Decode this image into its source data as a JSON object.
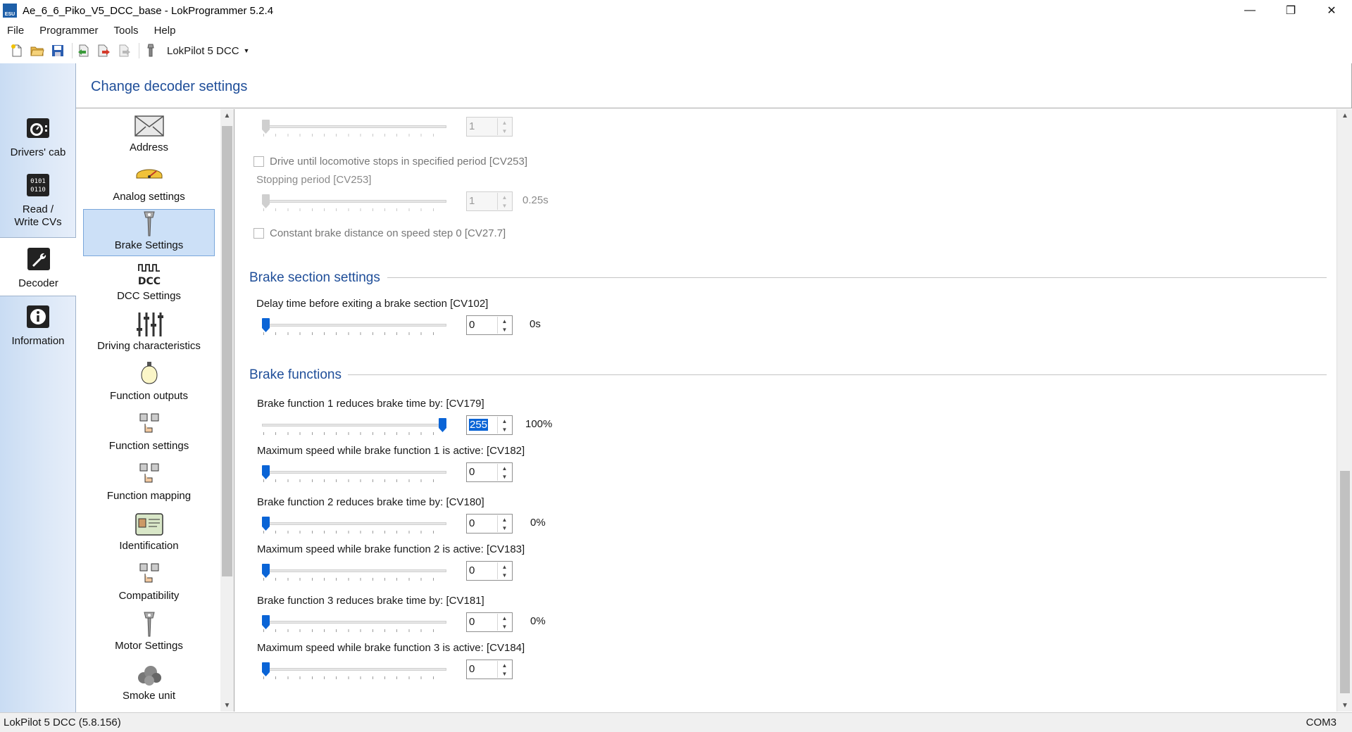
{
  "window": {
    "title": "Ae_6_6_Piko_V5_DCC_base - LokProgrammer 5.2.4",
    "app_icon_text": "ESU"
  },
  "menu": [
    "File",
    "Programmer",
    "Tools",
    "Help"
  ],
  "toolbar": {
    "icons": [
      "new-file-icon",
      "open-folder-icon",
      "save-icon",
      "read-decoder-icon",
      "write-decoder-icon",
      "flash-decoder-icon",
      "decoder-tool-icon"
    ],
    "decoder_select": "LokPilot 5 DCC"
  },
  "leftnav": {
    "items": [
      {
        "label": "Drivers' cab",
        "icon": "drivers-cab-icon"
      },
      {
        "label": "Read / Write CVs",
        "icon": "cv-grid-icon"
      },
      {
        "label": "Decoder",
        "icon": "wrench-icon",
        "active": true
      },
      {
        "label": "Information",
        "icon": "info-icon"
      }
    ]
  },
  "header": {
    "title": "Change decoder settings"
  },
  "categories": [
    {
      "label": "Address",
      "icon": "envelope-icon"
    },
    {
      "label": "Analog settings",
      "icon": "analog-gauge-icon"
    },
    {
      "label": "Brake Settings",
      "icon": "brake-icon",
      "selected": true
    },
    {
      "label": "DCC Settings",
      "icon": "dcc-icon"
    },
    {
      "label": "Driving characteristics",
      "icon": "sliders-icon"
    },
    {
      "label": "Function outputs",
      "icon": "bulb-icon"
    },
    {
      "label": "Function settings",
      "icon": "function-buttons-icon"
    },
    {
      "label": "Function mapping",
      "icon": "function-mapping-icon"
    },
    {
      "label": "Identification",
      "icon": "id-card-icon"
    },
    {
      "label": "Compatibility",
      "icon": "compatibility-icon"
    },
    {
      "label": "Motor Settings",
      "icon": "motor-icon"
    },
    {
      "label": "Smoke unit",
      "icon": "smoke-icon"
    }
  ],
  "content": {
    "top_slider": {
      "value": "1"
    },
    "drive_until_stop": {
      "label": "Drive until locomotive stops in specified period [CV253]",
      "checked": false
    },
    "stopping_period": {
      "label": "Stopping period [CV253]",
      "value": "1",
      "unit": "0.25s"
    },
    "constant_brake": {
      "label": "Constant brake distance on speed step 0 [CV27.7]",
      "checked": false
    },
    "brake_section": {
      "title": "Brake section settings",
      "delay": {
        "label": "Delay time before exiting a brake section [CV102]",
        "value": "0",
        "unit": "0s",
        "level": 0
      }
    },
    "brake_functions": {
      "title": "Brake functions",
      "rows": [
        {
          "label": "Brake function 1 reduces brake time by: [CV179]",
          "value": "255",
          "unit": "100%",
          "level": 1.0
        },
        {
          "label": "Maximum speed while brake function 1 is active: [CV182]",
          "value": "0",
          "unit": "",
          "level": 0
        },
        {
          "label": "Brake function 2 reduces brake time by: [CV180]",
          "value": "0",
          "unit": "0%",
          "level": 0
        },
        {
          "label": "Maximum speed while brake function 2 is active: [CV183]",
          "value": "0",
          "unit": "",
          "level": 0
        },
        {
          "label": "Brake function 3 reduces brake time by: [CV181]",
          "value": "0",
          "unit": "0%",
          "level": 0
        },
        {
          "label": "Maximum speed while brake function 3 is active: [CV184]",
          "value": "0",
          "unit": "",
          "level": 0
        }
      ]
    }
  },
  "status": {
    "left": "LokPilot 5 DCC (5.8.156)",
    "right": "COM3"
  }
}
